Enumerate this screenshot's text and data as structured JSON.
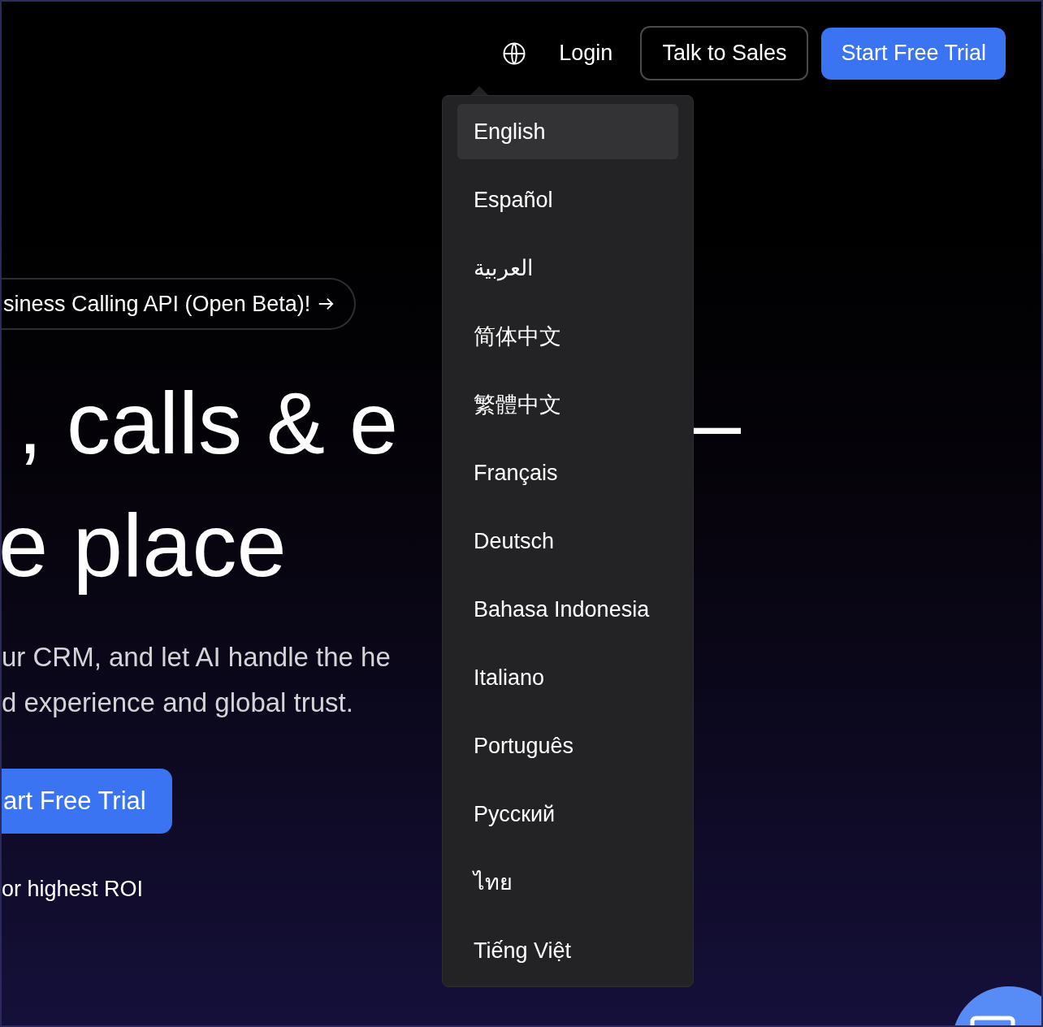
{
  "nav": {
    "login": "Login",
    "talk_to_sales": "Talk to Sales",
    "start_trial": "Start Free Trial"
  },
  "language_menu": {
    "items": [
      {
        "label": "English",
        "selected": true
      },
      {
        "label": "Español",
        "selected": false
      },
      {
        "label": "العربية",
        "selected": false
      },
      {
        "label": "简体中文",
        "selected": false
      },
      {
        "label": "繁體中文",
        "selected": false
      },
      {
        "label": "Français",
        "selected": false
      },
      {
        "label": "Deutsch",
        "selected": false
      },
      {
        "label": "Bahasa Indonesia",
        "selected": false
      },
      {
        "label": "Italiano",
        "selected": false
      },
      {
        "label": "Português",
        "selected": false
      },
      {
        "label": "Русский",
        "selected": false
      },
      {
        "label": "ไทย",
        "selected": false
      },
      {
        "label": "Tiếng Việt",
        "selected": false
      }
    ]
  },
  "hero": {
    "announcement": "siness Calling API (Open Beta)!",
    "headline_line_1": ", calls & e",
    "headline_dash": "–",
    "headline_line_2": "e place",
    "description_lines": [
      "ur CRM, and let AI handle the he",
      "d experience and global trust."
    ],
    "cta": "art Free Trial",
    "note": "or highest ROI"
  }
}
